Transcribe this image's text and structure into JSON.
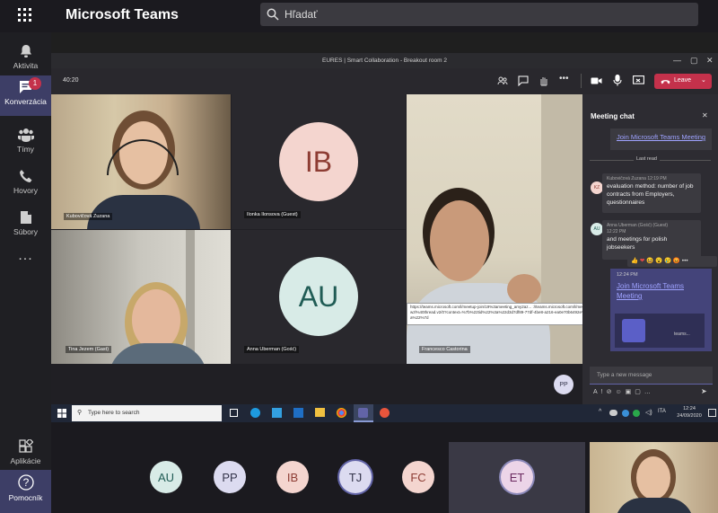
{
  "app": {
    "name": "Microsoft Teams",
    "search_placeholder": "Hľadať"
  },
  "rail": {
    "items": [
      {
        "label": "Aktivita",
        "icon": "bell-icon"
      },
      {
        "label": "Konverzácia",
        "icon": "chat-icon",
        "badge": "1"
      },
      {
        "label": "Tímy",
        "icon": "teams-icon"
      },
      {
        "label": "Hovory",
        "icon": "phone-icon"
      },
      {
        "label": "Súbory",
        "icon": "file-icon"
      },
      {
        "label": "...",
        "icon": "more-icon"
      }
    ],
    "bottom": [
      {
        "label": "Aplikácie",
        "icon": "apps-icon"
      },
      {
        "label": "Pomocník",
        "icon": "help-icon"
      }
    ]
  },
  "meeting": {
    "window_title": "EURES | Smart Collaboration - Breakout room 2",
    "timer": "40:20",
    "leave_label": "Leave",
    "tiles": [
      {
        "name": "Kubovičová Zuzana",
        "type": "video"
      },
      {
        "name": "Ilonka Ilonsova (Guest)",
        "type": "avatar",
        "initials": "IB"
      },
      {
        "name": "Francesco Castorina",
        "type": "video"
      },
      {
        "name": "Tina Jezem (Gast)",
        "type": "video"
      },
      {
        "name": "Anna Uberman (Gość)",
        "type": "avatar",
        "initials": "AU"
      }
    ],
    "self_initials": "PP"
  },
  "chat": {
    "title": "Meeting chat",
    "top_link": "Join Microsoft Teams Meeting",
    "last_read": "Last read",
    "messages": [
      {
        "initials": "KZ",
        "author": "Kubovičová Zuzana",
        "time": "12:19 PM",
        "text": "evaluation method: number of job contracts from Employers, questionnaires"
      },
      {
        "initials": "AU",
        "author": "Anna Uberman (Gość) (Guest)",
        "time": "12:22 PM",
        "text": "and meetings for polish jobseekers"
      }
    ],
    "own_time": "12:24 PM",
    "own_link": "Join Microsoft Teams Meeting",
    "teams_label": "teams...",
    "url_tooltip": "https://teams.microsoft.com/l/meetup-join/19%3ameeting_amy2az... ://teams.microsoft.com/l/meetup-join/19%3ameeting_amy2azgqyrzzdsyl0ml2idjwzjzbatmwnyniqndnzwzl%40thread.v2/0?context=%7b%22tid%22%3a%22d3d7df89-77df-4be8-a216-ea0e70b6492e%22%2c%22oid%22%3a%22c5d7d6e28c-be26-493f-82eb-a56a7b13f5ca%22%7d",
    "input_placeholder": "Type a new message",
    "reactions": [
      "👍",
      "❤",
      "😆",
      "😮",
      "😢",
      "😡"
    ]
  },
  "taskbar": {
    "search_placeholder": "Type here to search",
    "lang": "ITA",
    "time": "12:24",
    "date": "24/09/2020"
  },
  "strip": {
    "participants": [
      "AU",
      "PP",
      "IB",
      "TJ",
      "FC",
      "ET"
    ]
  },
  "colors": {
    "accent": "#6264a7",
    "leave": "#c4314b",
    "taskbar": "#202737"
  }
}
